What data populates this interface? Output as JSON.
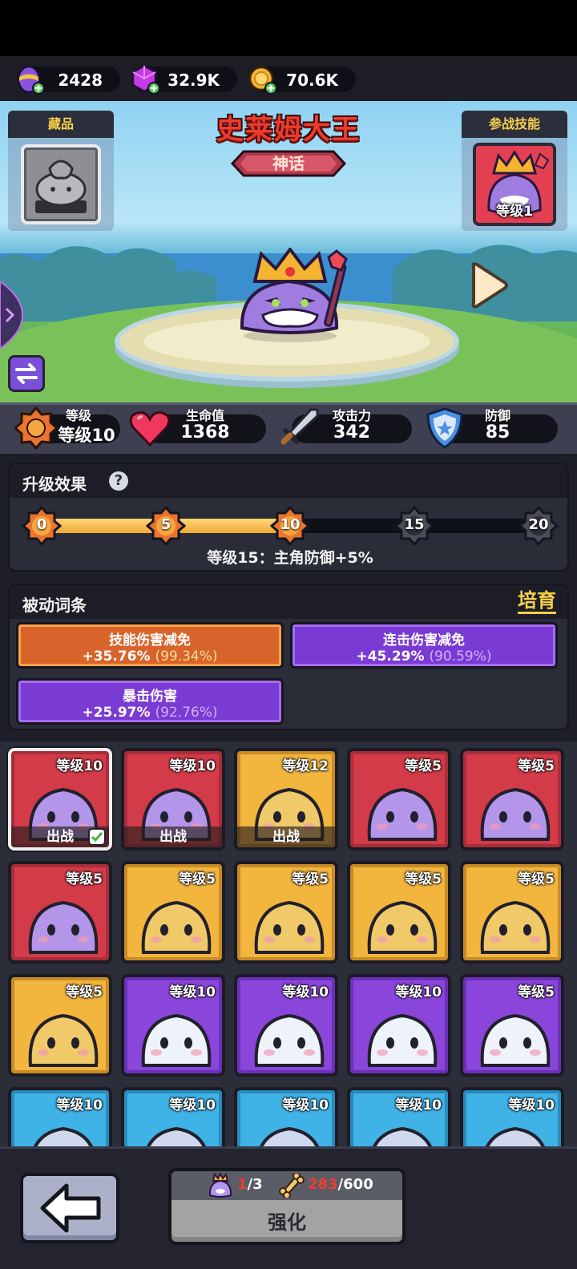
{
  "currencies": [
    {
      "name": "egg",
      "value": "2428"
    },
    {
      "name": "gem",
      "value": "32.9K"
    },
    {
      "name": "coin",
      "value": "70.6K"
    }
  ],
  "hero": {
    "name": "史莱姆大王",
    "rarity": "神话",
    "collection_label": "藏品",
    "battle_skill_label": "参战技能",
    "skill_level": "等级1"
  },
  "stats": {
    "level_label": "等级",
    "level_value": "等级10",
    "hp_label": "生命值",
    "hp_value": "1368",
    "atk_label": "攻击力",
    "atk_value": "342",
    "def_label": "防御",
    "def_value": "85"
  },
  "upgrade": {
    "title": "升级效果",
    "help": "?",
    "milestones": [
      "0",
      "5",
      "10",
      "15",
      "20"
    ],
    "progress_fraction": 0.5,
    "note": "等级15：主角防御+5%"
  },
  "passive": {
    "title": "被动词条",
    "cultivate": "培育",
    "traits": [
      {
        "name": "技能伤害减免",
        "value": "+35.76%",
        "pct": "(99.34%)",
        "color": "orange"
      },
      {
        "name": "连击伤害减免",
        "value": "+45.29%",
        "pct": "(90.59%)",
        "color": "purple"
      },
      {
        "name": "暴击伤害",
        "value": "+25.97%",
        "pct": "(92.76%)",
        "color": "purple"
      }
    ]
  },
  "pets": [
    {
      "level": "等级10",
      "deploy": "出战",
      "color": "red",
      "selected": true,
      "check": true
    },
    {
      "level": "等级10",
      "deploy": "出战",
      "color": "red"
    },
    {
      "level": "等级12",
      "deploy": "出战",
      "color": "gold"
    },
    {
      "level": "等级5",
      "color": "red"
    },
    {
      "level": "等级5",
      "color": "red"
    },
    {
      "level": "等级5",
      "color": "red"
    },
    {
      "level": "等级5",
      "color": "gold"
    },
    {
      "level": "等级5",
      "color": "gold"
    },
    {
      "level": "等级5",
      "color": "gold"
    },
    {
      "level": "等级5",
      "color": "gold"
    },
    {
      "level": "等级5",
      "color": "gold"
    },
    {
      "level": "等级10",
      "color": "purple"
    },
    {
      "level": "等级10",
      "color": "purple"
    },
    {
      "level": "等级10",
      "color": "purple"
    },
    {
      "level": "等级5",
      "color": "purple"
    },
    {
      "level": "等级10",
      "color": "cyan"
    },
    {
      "level": "等级10",
      "color": "cyan"
    },
    {
      "level": "等级10",
      "color": "cyan"
    },
    {
      "level": "等级10",
      "color": "cyan"
    },
    {
      "level": "等级10",
      "color": "cyan"
    }
  ],
  "bottom": {
    "fragments_have": "1",
    "fragments_need": "/3",
    "bones_have": "283",
    "bones_need": "/600",
    "enhance_label": "强化"
  }
}
